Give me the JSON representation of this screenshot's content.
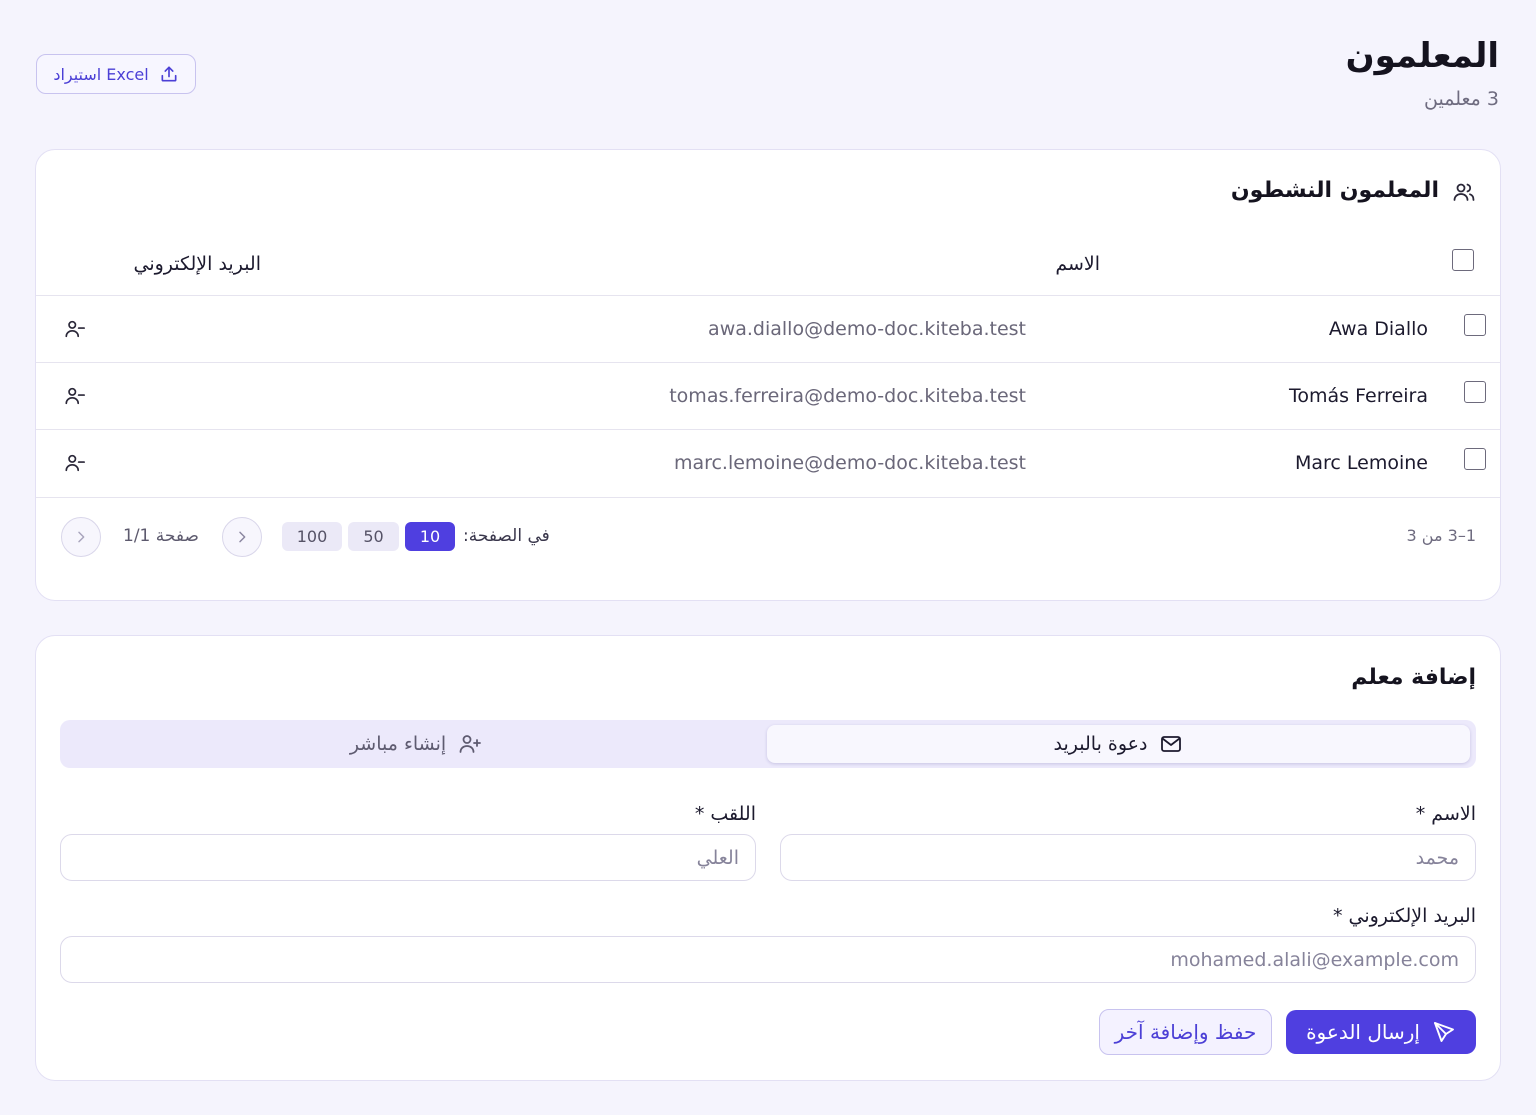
{
  "header": {
    "title": "المعلمون",
    "subtitle": "3 معلمين",
    "import_label": "استيراد Excel"
  },
  "teachers_card": {
    "title": "المعلمون النشطون",
    "columns": {
      "name": "الاسم",
      "email": "البريد الإلكتروني"
    },
    "rows": [
      {
        "name": "Awa Diallo",
        "email": "awa.diallo@demo-doc.kiteba.test"
      },
      {
        "name": "Tomás Ferreira",
        "email": "tomas.ferreira@demo-doc.kiteba.test"
      },
      {
        "name": "Marc Lemoine",
        "email": "marc.lemoine@demo-doc.kiteba.test"
      }
    ],
    "pagination": {
      "count": "1–3 من 3",
      "per_page_label": "في الصفحة:",
      "sizes": [
        "10",
        "50",
        "100"
      ],
      "active_size": "10",
      "page_info": "صفحة 1/1"
    }
  },
  "add_card": {
    "title": "إضافة معلم",
    "tabs": [
      {
        "label": "دعوة بالبريد",
        "active": true
      },
      {
        "label": "إنشاء مباشر",
        "active": false
      }
    ],
    "first_name": {
      "label": "الاسم *",
      "placeholder": "محمد"
    },
    "last_name": {
      "label": "اللقب *",
      "placeholder": "العلي"
    },
    "email": {
      "label": "البريد الإلكتروني *",
      "placeholder": "mohamed.alali@example.com"
    },
    "send_label": "إرسال الدعوة",
    "save_add_label": "حفظ وإضافة آخر"
  },
  "colors": {
    "accent": "#4f3fe0",
    "background": "#f5f4fd"
  }
}
